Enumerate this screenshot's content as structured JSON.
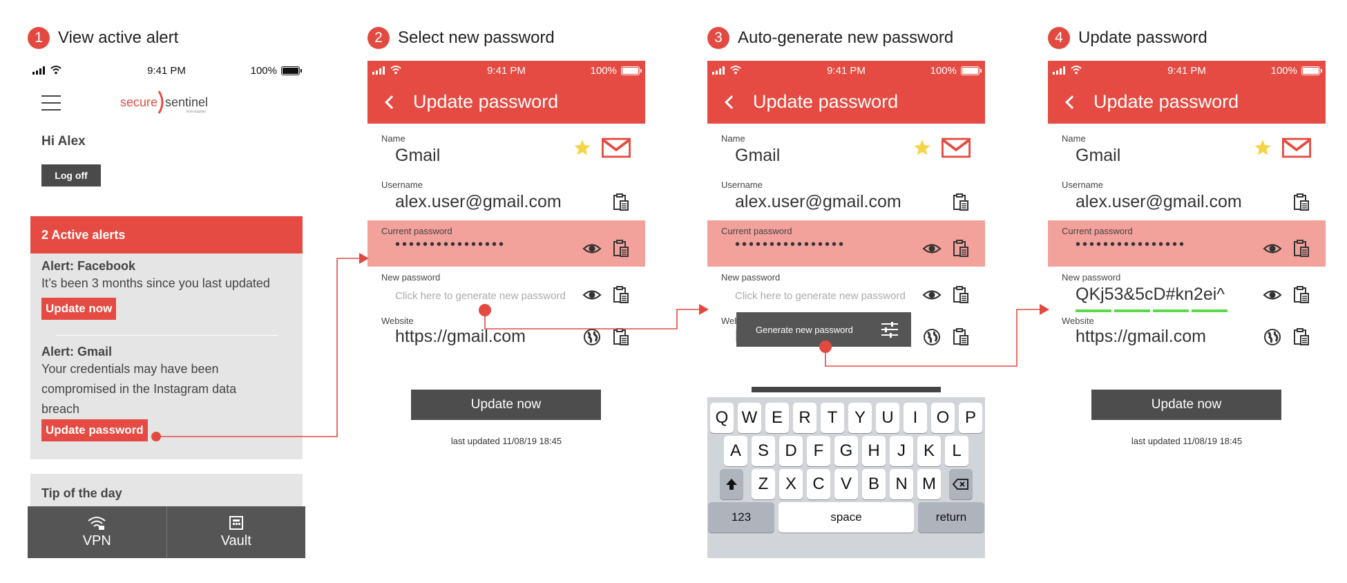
{
  "steps": [
    {
      "num": "1",
      "title": "View active alert"
    },
    {
      "num": "2",
      "title": "Select new password"
    },
    {
      "num": "3",
      "title": "Auto-generate new password"
    },
    {
      "num": "4",
      "title": "Update password"
    }
  ],
  "status": {
    "time": "9:41 PM",
    "battery": "100%"
  },
  "colors": {
    "brand_red": "#e54b42",
    "highlight": "#f3a19b",
    "dark_gray": "#4d4d4d",
    "strength_green": "#5ad84a"
  },
  "home": {
    "logo_text": {
      "a": "secure",
      "b": "sentinel",
      "c": "from Equifax"
    },
    "greeting": "Hi Alex",
    "logoff": "Log off",
    "alerts_header": "2 Active alerts",
    "alert1": {
      "title": "Alert: Facebook",
      "text": "It’s been 3 months since you last updated",
      "button": "Update now"
    },
    "alert2": {
      "title": "Alert: Gmail",
      "text_lines": [
        "Your credentials may have been",
        "compromised in the Instagram data",
        "breach"
      ],
      "button": "Update password"
    },
    "tip": "Tip of the day",
    "tabs": [
      {
        "label": "VPN",
        "icon": "wifi-lock-icon"
      },
      {
        "label": "Vault",
        "icon": "vault-icon"
      }
    ]
  },
  "form": {
    "header": "Update password",
    "name_label": "Name",
    "name_value": "Gmail",
    "username_label": "Username",
    "username_value": "alex.user@gmail.com",
    "current_label": "Current password",
    "current_value": "••••••••••••••••",
    "new_label": "New password",
    "new_placeholder": "Click here to generate new password",
    "website_label": "Website",
    "website_value": "https://gmail.com",
    "button": "Update now",
    "last_updated": "last updated 11/08/19 18:45"
  },
  "generated_password": "QKj53&5cD#kn2ei^",
  "password_strength": {
    "filled_segments": 4,
    "total_segments": 4
  },
  "popup": {
    "label": "Generate new password"
  },
  "keyboard": {
    "row1": [
      "Q",
      "W",
      "E",
      "R",
      "T",
      "Y",
      "U",
      "I",
      "O",
      "P"
    ],
    "row2": [
      "A",
      "S",
      "D",
      "F",
      "G",
      "H",
      "J",
      "K",
      "L"
    ],
    "row3": [
      "Z",
      "X",
      "C",
      "V",
      "B",
      "N",
      "M"
    ],
    "num_key": "123",
    "space_key": "space",
    "return_key": "return"
  }
}
